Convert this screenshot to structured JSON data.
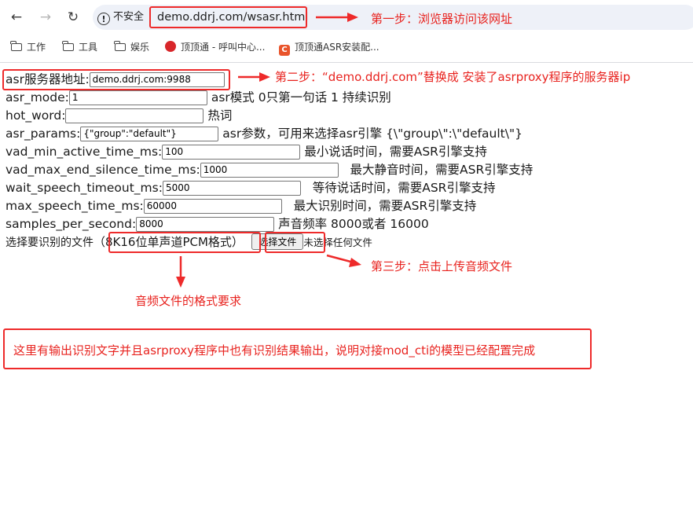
{
  "browser": {
    "security_label": "不安全",
    "url": "demo.ddrj.com/wsasr.html",
    "bookmarks": [
      {
        "label": "工作",
        "icon": "folder-icon"
      },
      {
        "label": "工具",
        "icon": "folder-icon"
      },
      {
        "label": "娱乐",
        "icon": "folder-icon"
      },
      {
        "label": "顶顶通 - 呼叫中心...",
        "icon": "dingdingtong-icon"
      },
      {
        "label": "顶顶通ASR安装配...",
        "icon": "csdn-icon"
      }
    ]
  },
  "form": {
    "asr_server": {
      "label": "asr服务器地址:",
      "value": "demo.ddrj.com:9988"
    },
    "asr_mode": {
      "label": "asr_mode:",
      "value": "1",
      "hint": "asr模式 0只第一句话 1 持续识别"
    },
    "hot_word": {
      "label": "hot_word:",
      "value": "",
      "hint": "热词"
    },
    "asr_params": {
      "label": "asr_params:",
      "value": "{\"group\":\"default\"}",
      "hint": "asr参数，可用来选择asr引擎 {\\\"group\\\":\\\"default\\\"}"
    },
    "vad_min_active_time_ms": {
      "label": "vad_min_active_time_ms:",
      "value": "100",
      "hint": "最小说话时间，需要ASR引擎支持"
    },
    "vad_max_end_silence_time_ms": {
      "label": "vad_max_end_silence_time_ms:",
      "value": "1000",
      "hint": "最大静音时间，需要ASR引擎支持"
    },
    "wait_speech_timeout_ms": {
      "label": "wait_speech_timeout_ms:",
      "value": "5000",
      "hint": "等待说话时间，需要ASR引擎支持"
    },
    "max_speech_time_ms": {
      "label": "max_speech_time_ms:",
      "value": "60000",
      "hint": "最大识别时间，需要ASR引擎支持"
    },
    "samples_per_second": {
      "label": "samples_per_second:",
      "value": "8000",
      "hint": "声音频率 8000或者 16000"
    },
    "file": {
      "label": "选择要识别的文件",
      "format": "（8K16位单声道PCM格式）",
      "button": "选择文件",
      "status": "未选择任何文件"
    }
  },
  "annotations": {
    "step1": "第一步：浏览器访问该网址",
    "step2": "第二步：“demo.ddrj.com”替换成 安装了asrproxy程序的服务器ip",
    "step3": "第三步：点击上传音频文件",
    "format_note": "音频文件的格式要求",
    "result_note": "这里有输出识别文字并且asrproxy程序中也有识别结果输出，说明对接mod_cti的模型已经配置完成"
  },
  "colors": {
    "annotation": "#ee2a2a"
  }
}
